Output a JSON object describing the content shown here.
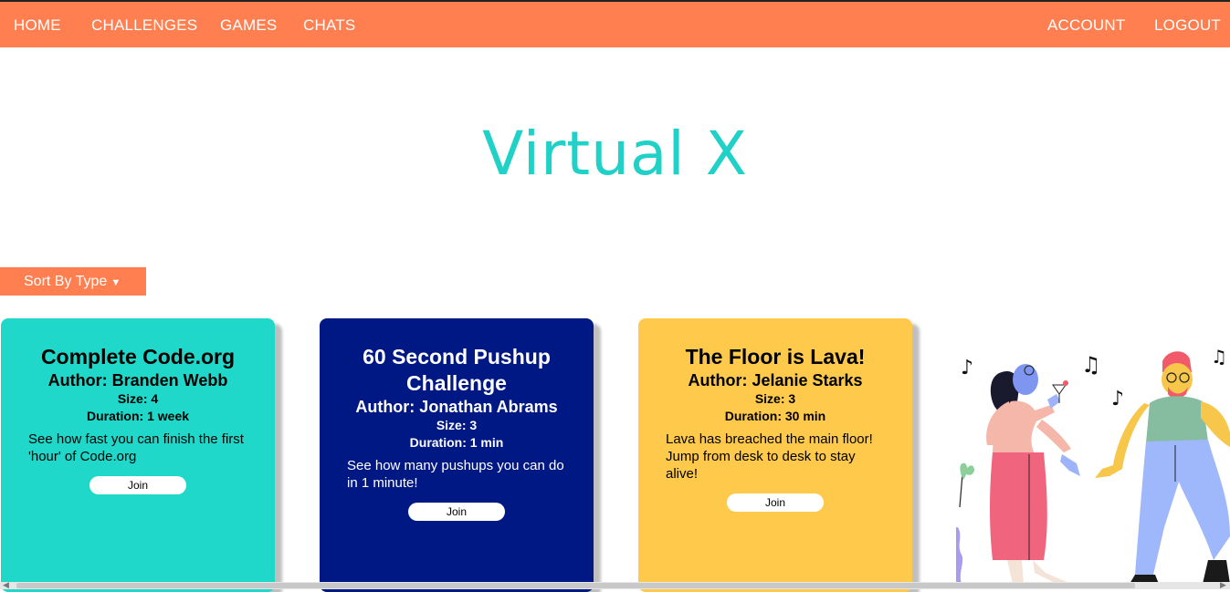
{
  "nav": {
    "left": [
      "HOME",
      "CHALLENGES",
      "GAMES",
      "CHATS"
    ],
    "right": [
      "ACCOUNT",
      "LOGOUT"
    ]
  },
  "hero": {
    "title": "Virtual X"
  },
  "sort": {
    "label": "Sort By Type",
    "caret_icon": "caret-down-icon"
  },
  "cards": [
    {
      "title": "Complete Code.org",
      "author": "Author: Branden Webb",
      "size": "Size: 4",
      "duration": "Duration: 1 week",
      "description": "See how fast you can finish the first 'hour' of Code.org",
      "join": "Join",
      "bg": "#1fd8c9",
      "fg": "#000000"
    },
    {
      "title": "60 Second Pushup Challenge",
      "author": "Author: Jonathan Abrams",
      "size": "Size: 3",
      "duration": "Duration: 1 min",
      "description": "See how many pushups you can do in 1 minute!",
      "join": "Join",
      "bg": "#001883",
      "fg": "#ffffff"
    },
    {
      "title": "The Floor is Lava!",
      "author": "Author: Jelanie Starks",
      "size": "Size: 3",
      "duration": "Duration: 30 min",
      "description": "Lava has breached the main floor! Jump from desk to desk to stay alive!",
      "join": "Join",
      "bg": "#ffc94c",
      "fg": "#000000"
    }
  ],
  "colors": {
    "accent": "#ff7f50",
    "brand": "#1fd1c6"
  }
}
